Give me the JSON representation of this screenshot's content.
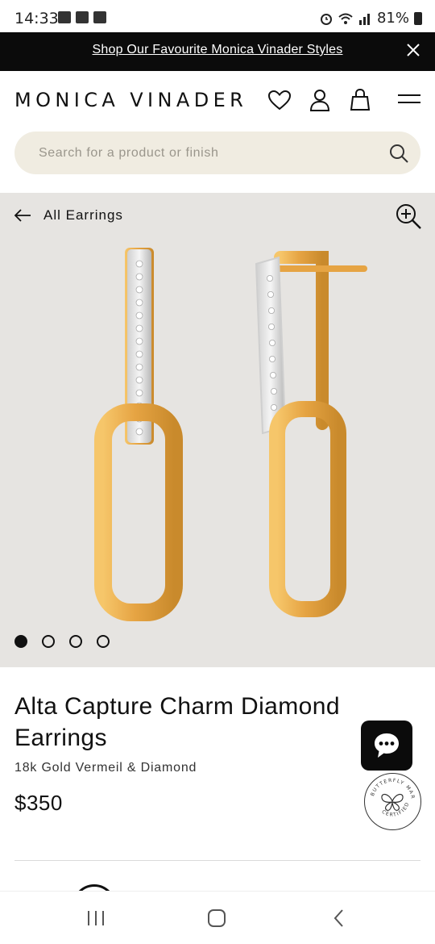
{
  "status_bar": {
    "time": "14:33",
    "battery": "81%"
  },
  "promo": {
    "text": "Shop Our Favourite Monica Vinader Styles"
  },
  "header": {
    "logo": "MONICA VINADER"
  },
  "search": {
    "placeholder": "Search for a product or finish"
  },
  "gallery": {
    "back_label": "All Earrings",
    "slide_count": 4,
    "active_slide": 1
  },
  "product": {
    "title": "Alta Capture Charm Diamond Earrings",
    "material": "18k Gold Vermeil & Diamond",
    "price": "$350"
  },
  "badge": {
    "top_text": "BUTTERFLY MARK",
    "bottom_text": "CERTIFIED"
  },
  "colors": {
    "banner_bg": "#0b0b0b",
    "search_bg": "#f0ece1",
    "gallery_bg": "#e6e4e1",
    "gold": "#e8a94a",
    "text": "#111111"
  }
}
